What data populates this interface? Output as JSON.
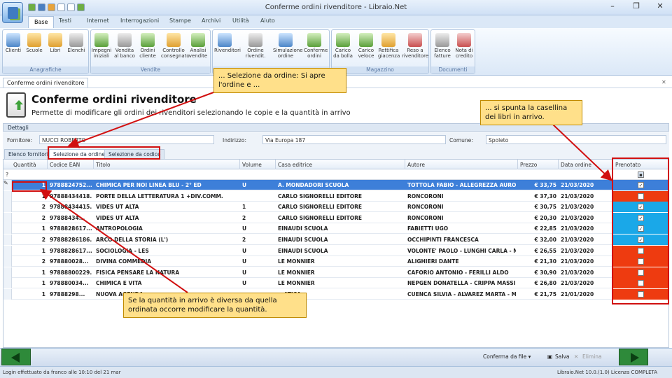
{
  "window": {
    "title": "Conferme ordini rivenditore - Libraio.Net",
    "controls": [
      "–",
      "❐",
      "✕"
    ]
  },
  "ribbon_tabs": [
    "Base",
    "Testi",
    "Internet",
    "Interrogazioni",
    "Stampe",
    "Archivi",
    "Utilità",
    "Aiuto"
  ],
  "ribbon": {
    "groups": [
      {
        "label": "Anagrafiche",
        "buttons": [
          "Clienti",
          "Scuole",
          "Libri",
          "Elenchi"
        ]
      },
      {
        "label": "Vendite",
        "buttons": [
          "Impegni iniziali",
          "Vendita al banco",
          "Ordini cliente",
          "Controllo consegnato",
          "Analisi vendite"
        ]
      },
      {
        "label": "",
        "buttons": [
          "Rivenditori",
          "Ordine rivendit.",
          "Simulazione ordine",
          "Conferme ordini"
        ]
      },
      {
        "label": "Magazzino",
        "buttons": [
          "Carico da bolla",
          "Carico veloce",
          "Rettifica giacenza",
          "Reso a rivenditore"
        ]
      },
      {
        "label": "Documenti",
        "buttons": [
          "Elenco fatture",
          "Nota di credito"
        ]
      }
    ]
  },
  "doc_tab": "Conferme ordini rivenditore",
  "doc_close": "✕",
  "header": {
    "title": "Conferme ordini rivenditore",
    "subtitle": "Permette di modificare gli ordini dei rivenditori selezionando le copie e la quantità in arrivo"
  },
  "section_label": "Dettagli",
  "filters": {
    "fornitore_label": "Fornitore:",
    "fornitore_value": "NUCCI ROBERTO",
    "indirizzo_label": "Indirizzo:",
    "indirizzo_value": "Via Europa 187",
    "comune_label": "Comune:",
    "comune_value": "Spoleto"
  },
  "subtabs": [
    "Elenco fornitori",
    "Selezione da ordine",
    "Selezione da codice"
  ],
  "grid": {
    "columns": [
      "Quantità",
      "Codice EAN",
      "Titolo",
      "Volume",
      "Casa editrice",
      "Autore",
      "Prezzo",
      "Data ordine",
      "Prenotato"
    ],
    "rows": [
      {
        "qty": "1",
        "ean": "9788824752...",
        "title": "CHIMICA PER NOI LINEA BLU - 2° ED",
        "vol": "U",
        "pub": "A. MONDADORI SCUOLA",
        "author": "TOTTOLA FABIO - ALLEGREZZA AURO...",
        "price": "€ 33,75",
        "date": "21/03/2020",
        "checked": true
      },
      {
        "qty": "1",
        "ean": "97888434418...",
        "title": "PORTE DELLA LETTERATURA 1 +DIV.COMM.",
        "vol": "",
        "pub": "CARLO SIGNORELLI EDITORE",
        "author": "RONCORONI",
        "price": "€ 37,30",
        "date": "21/03/2020",
        "checked": false
      },
      {
        "qty": "2",
        "ean": "97888434415...",
        "title": "VIDES UT ALTA",
        "vol": "1",
        "pub": "CARLO SIGNORELLI EDITORE",
        "author": "RONCORONI",
        "price": "€ 30,75",
        "date": "21/03/2020",
        "checked": true
      },
      {
        "qty": "2",
        "ean": "97888434...",
        "title": "VIDES UT ALTA",
        "vol": "2",
        "pub": "CARLO SIGNORELLI EDITORE",
        "author": "RONCORONI",
        "price": "€ 20,30",
        "date": "21/03/2020",
        "checked": true
      },
      {
        "qty": "1",
        "ean": "9788828617...",
        "title": "ANTROPOLOGIA",
        "vol": "U",
        "pub": "EINAUDI SCUOLA",
        "author": "FABIETTI UGO",
        "price": "€ 22,85",
        "date": "21/03/2020",
        "checked": true
      },
      {
        "qty": "2",
        "ean": "97888286186...",
        "title": "ARCO DELLA STORIA (L')",
        "vol": "2",
        "pub": "EINAUDI SCUOLA",
        "author": "OCCHIPINTI FRANCESCA",
        "price": "€ 32,00",
        "date": "21/03/2020",
        "checked": true
      },
      {
        "qty": "1",
        "ean": "9788828617...",
        "title": "SOCIOLOGIA - LES",
        "vol": "U",
        "pub": "EINAUDI SCUOLA",
        "author": "VOLONTE' PAOLO - LUNGHI CARLA - M...",
        "price": "€ 26,55",
        "date": "21/03/2020",
        "checked": false
      },
      {
        "qty": "2",
        "ean": "978880028...",
        "title": "DIVINA COMMEDIA",
        "vol": "U",
        "pub": "LE MONNIER",
        "author": "ALIGHIERI DANTE",
        "price": "€ 21,30",
        "date": "21/03/2020",
        "checked": false
      },
      {
        "qty": "1",
        "ean": "97888800229...",
        "title": "FISICA PENSARE LA NATURA",
        "vol": "U",
        "pub": "LE MONNIER",
        "author": "CAFORIO ANTONIO - FERILLI ALDO",
        "price": "€ 30,90",
        "date": "21/03/2020",
        "checked": false
      },
      {
        "qty": "1",
        "ean": "978880034...",
        "title": "CHIMICA E VITA",
        "vol": "U",
        "pub": "LE MONNIER",
        "author": "NEPGEN DONATELLA - CRIPPA MASSI...",
        "price": "€ 26,80",
        "date": "21/03/2020",
        "checked": false
      },
      {
        "qty": "1",
        "ean": "97888298...",
        "title": "NUOVA AGENDA...",
        "vol": "",
        "pub": "...ATICA",
        "author": "CUENCA SILVIA - ALVAREZ MARTA - M...",
        "price": "€ 21,75",
        "date": "21/01/2020",
        "checked": false
      }
    ]
  },
  "actions": {
    "conferma": "Conferma da file ▾",
    "salva": "Salva",
    "elimina": "Elimina"
  },
  "status": {
    "login": "Login effettuato da franco alle 10:10 del 21 mar",
    "version": "Libraio.Net 10.0.(1.0) Licenza COMPLETA"
  },
  "callouts": {
    "top": "... Selezione da ordine: Si apre l'ordine e ...",
    "right": "... si spunta la casellina dei libri in arrivo.",
    "bottom": "Se la quantità in arrivo è diversa da quella ordinata occorre modificare la quantità."
  },
  "colors": {
    "selected_row": "#3d7fd9",
    "checked_cell": "#1aa8e8",
    "unchecked_cell": "#ee3b10",
    "callout_bg": "#ffe08a",
    "highlight": "#d11010"
  }
}
